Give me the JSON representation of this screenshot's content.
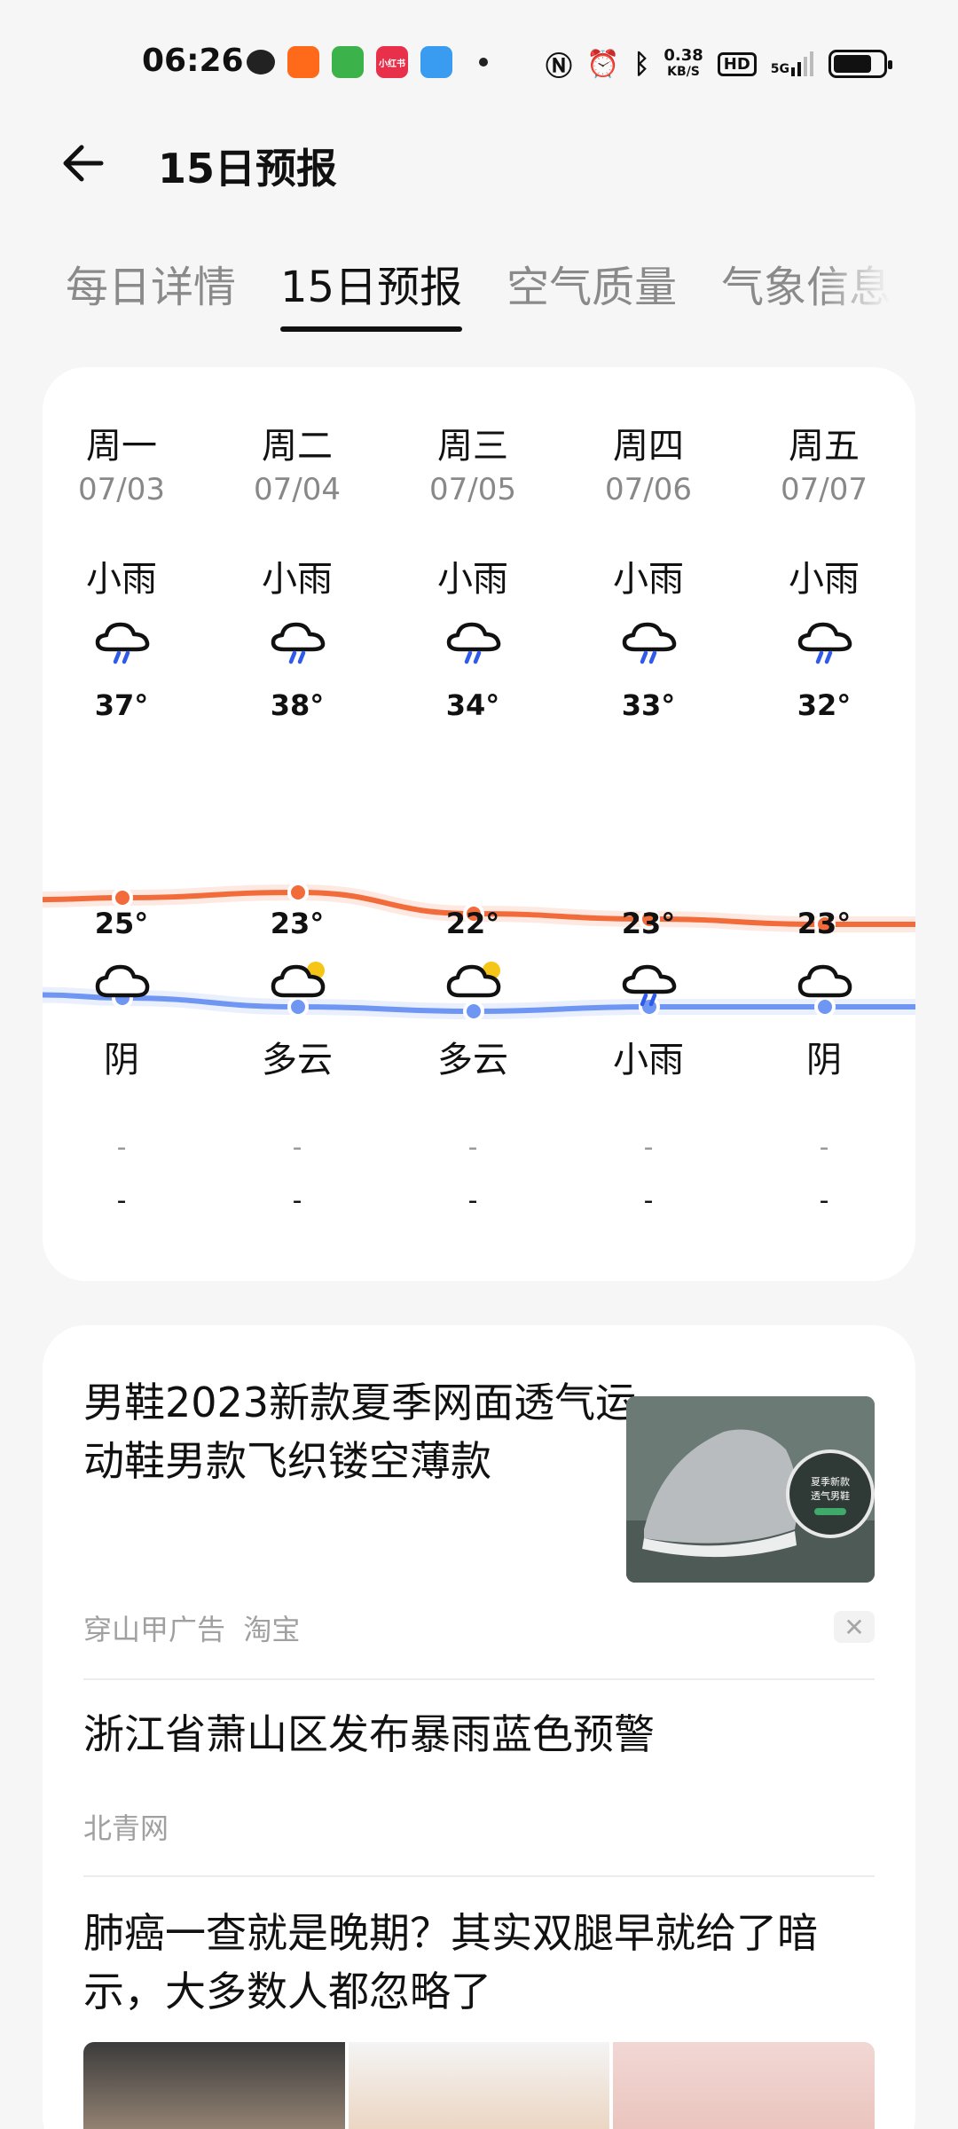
{
  "status_bar": {
    "time": "06:26",
    "apps": [
      {
        "icon": "wechat-icon",
        "color": "#222222",
        "label": ""
      },
      {
        "icon": "kuaishou-icon",
        "color": "#ff6a1a",
        "label": ""
      },
      {
        "icon": "shop-icon",
        "color": "#3cb34a",
        "label": ""
      },
      {
        "icon": "xiaohongshu-icon",
        "color": "#e8304a",
        "label": "小红书"
      },
      {
        "icon": "weather-app-icon",
        "color": "#3a9cf0",
        "label": ""
      }
    ],
    "net_speed": "0.38",
    "net_unit": "KB/S",
    "hd_label": "HD",
    "signal_label": "5G",
    "battery_level": 0.78
  },
  "header": {
    "back_icon": "arrow-left-icon",
    "title": "15日预报"
  },
  "tabs": [
    {
      "label": "每日详情",
      "active": false
    },
    {
      "label": "15日预报",
      "active": true
    },
    {
      "label": "空气质量",
      "active": false
    },
    {
      "label": "气象信息",
      "active": false
    }
  ],
  "forecast": {
    "days": [
      {
        "weekday": "周一",
        "date": "07/03",
        "day_condition": "小雨",
        "day_icon": "rain-icon",
        "high": "37°",
        "low": "25°",
        "night_icon": "cloudy-icon",
        "night_condition": "阴",
        "wind_1": "-",
        "wind_2": "-"
      },
      {
        "weekday": "周二",
        "date": "07/04",
        "day_condition": "小雨",
        "day_icon": "rain-icon",
        "high": "38°",
        "low": "23°",
        "night_icon": "partly-cloudy-icon",
        "night_condition": "多云",
        "wind_1": "-",
        "wind_2": "-"
      },
      {
        "weekday": "周三",
        "date": "07/05",
        "day_condition": "小雨",
        "day_icon": "rain-icon",
        "high": "34°",
        "low": "22°",
        "night_icon": "partly-cloudy-icon",
        "night_condition": "多云",
        "wind_1": "-",
        "wind_2": "-"
      },
      {
        "weekday": "周四",
        "date": "07/06",
        "day_condition": "小雨",
        "day_icon": "rain-icon",
        "high": "33°",
        "low": "23°",
        "night_icon": "rain-icon",
        "night_condition": "小雨",
        "wind_1": "-",
        "wind_2": "-"
      },
      {
        "weekday": "周五",
        "date": "07/07",
        "day_condition": "小雨",
        "day_icon": "rain-icon",
        "high": "32°",
        "low": "23°",
        "night_icon": "cloudy-icon",
        "night_condition": "阴",
        "wind_1": "-",
        "wind_2": "-"
      }
    ],
    "high_values": [
      37,
      38,
      34,
      33,
      32
    ],
    "low_values": [
      25,
      23,
      22,
      23,
      23
    ],
    "high_color": "#f26b3a",
    "low_color": "#6e96f2"
  },
  "feed": {
    "ad": {
      "title": "男鞋2023新款夏季网面透气运动鞋男款飞织镂空薄款",
      "source": "穿山甲广告",
      "platform": "淘宝",
      "image_badge_line1": "夏季新款",
      "image_badge_line2": "透气男鞋",
      "close_icon": "close-icon"
    },
    "articles": [
      {
        "title": "浙江省萧山区发布暴雨蓝色预警",
        "source": "北青网"
      },
      {
        "title": "肺癌一查就是晚期？其实双腿早就给了暗示，大多数人都忽略了",
        "source": ""
      }
    ]
  }
}
